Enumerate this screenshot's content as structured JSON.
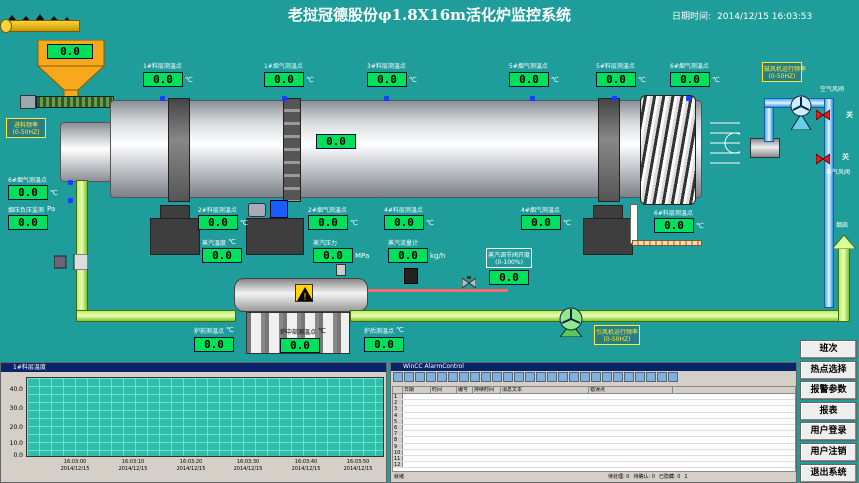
{
  "header": {
    "title": "老挝冠德股份φ1.8X16m活化炉监控系统",
    "date_label": "日期时间:",
    "datetime": "2014/12/15 16:03:53"
  },
  "hopper": {
    "value": "0.0"
  },
  "kiln": {
    "center_value": "0.0"
  },
  "top_points": [
    {
      "label": "1#料层测温点",
      "value": "0.0",
      "unit": "℃"
    },
    {
      "label": "1#烟气测温点",
      "value": "0.0",
      "unit": "℃"
    },
    {
      "label": "3#料层测温点",
      "value": "0.0",
      "unit": "℃"
    },
    {
      "label": "5#烟气测温点",
      "value": "0.0",
      "unit": "℃"
    },
    {
      "label": "5#料层测温点",
      "value": "0.0",
      "unit": "℃"
    },
    {
      "label": "6#烟气测温点",
      "value": "0.0",
      "unit": "℃"
    }
  ],
  "left_panel": {
    "feeder_label": "进料频率",
    "feeder_range": "(0-50HZ)",
    "flue6_label": "6#烟气测温点",
    "flue6_value": "0.0",
    "flue6_unit": "℃",
    "negp_label": "烟压负压监测",
    "negp_unit": "Pa",
    "negp_value": "0.0"
  },
  "mid_points": [
    {
      "label": "2#料层测温点",
      "value": "0.0",
      "unit": "℃"
    },
    {
      "label": "2#烟气测温点",
      "value": "0.0",
      "unit": "℃"
    },
    {
      "label": "4#料层测温点",
      "value": "0.0",
      "unit": "℃"
    },
    {
      "label": "4#烟气测温点",
      "value": "0.0",
      "unit": "℃"
    },
    {
      "label": "6#料层测温点",
      "value": "0.0",
      "unit": "℃"
    }
  ],
  "steam": {
    "temp_label": "蒸汽温度",
    "temp_value": "0.0",
    "temp_unit": "℃",
    "press_label": "蒸汽压力",
    "press_value": "0.0",
    "press_unit": "MPa",
    "flow_label": "蒸汽流量计",
    "flow_value": "0.0",
    "flow_unit": "kg/h",
    "valve_label": "蒸汽调节阀开度",
    "valve_range": "(0-100%)",
    "valve_value": "0.0"
  },
  "boiler": {
    "left_label": "炉前测温点",
    "left_value": "0.0",
    "mid_label": "炉中部测温点",
    "mid_value": "0.0",
    "right_label": "炉后测温点",
    "right_value": "0.0",
    "unit": "℃"
  },
  "right_panel": {
    "fan_label": "鼓风机运行频率",
    "fan_range": "(0-50HZ)",
    "air_valve_label": "空气风阀",
    "steam_valve_label": "蒸气风阀",
    "close1": "关",
    "close2": "关",
    "chimney_label": "烟囱"
  },
  "induced_fan": {
    "label": "引风机运行频率",
    "range": "(0-50HZ)"
  },
  "trend": {
    "title": "1#料层温度",
    "y_ticks": [
      "40.0",
      "30.0",
      "20.0",
      "10.0",
      "0.0"
    ],
    "x_ticks": [
      {
        "time": "16:03:00",
        "date": "2014/12/15"
      },
      {
        "time": "16:03:10",
        "date": "2014/12/15"
      },
      {
        "time": "16:03:20",
        "date": "2014/12/15"
      },
      {
        "time": "16:03:30",
        "date": "2014/12/15"
      },
      {
        "time": "16:03:40",
        "date": "2014/12/15"
      },
      {
        "time": "16:03:50",
        "date": "2014/12/15"
      }
    ]
  },
  "alarm": {
    "title": "WinCC AlarmControl",
    "columns": [
      "",
      "日期",
      "时间",
      "编号",
      "持续时间",
      "消息文本",
      "错误点"
    ],
    "rows": [
      "1",
      "2",
      "3",
      "4",
      "5",
      "6",
      "7",
      "8",
      "9",
      "10",
      "11",
      "12"
    ],
    "status_ready": "就绪",
    "status_pending": "待处理: 0",
    "status_pending2": "待确认: 0",
    "status_hidden": "已隐藏: 0",
    "status_count": "1"
  },
  "buttons": [
    "班次",
    "热点选择",
    "报警参数",
    "报表",
    "用户登录",
    "用户注销",
    "退出系统"
  ]
}
